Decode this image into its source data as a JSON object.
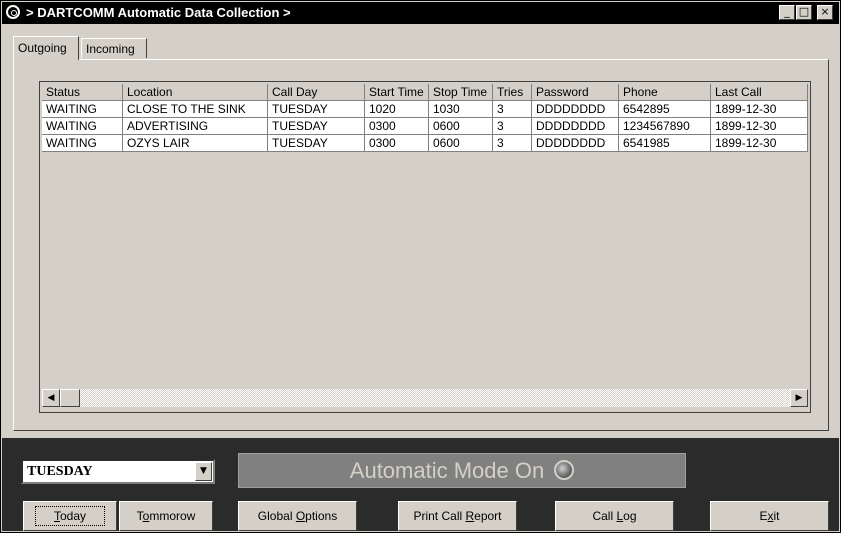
{
  "window": {
    "title": "> DARTCOMM Automatic Data Collection >",
    "min_glyph": "_",
    "max_glyph": "□",
    "close_glyph": "×"
  },
  "tabs": [
    {
      "label": "Outgoing",
      "active": true
    },
    {
      "label": "Incoming",
      "active": false
    }
  ],
  "grid": {
    "columns": [
      "Status",
      "Location",
      "Call Day",
      "Start Time",
      "Stop Time",
      "Tries",
      "Password",
      "Phone",
      "Last Call"
    ],
    "rows": [
      [
        "WAITING",
        "CLOSE TO THE SINK",
        "TUESDAY",
        "1020",
        "1030",
        "3",
        "DDDDDDDD",
        "6542895",
        "1899-12-30"
      ],
      [
        "WAITING",
        "ADVERTISING",
        "TUESDAY",
        "0300",
        "0600",
        "3",
        "DDDDDDDD",
        "1234567890",
        "1899-12-30"
      ],
      [
        "WAITING",
        "OZYS LAIR",
        "TUESDAY",
        "0300",
        "0600",
        "3",
        "DDDDDDDD",
        "6541985",
        "1899-12-30"
      ]
    ],
    "scroll_left_glyph": "◀",
    "scroll_right_glyph": "▶"
  },
  "controls": {
    "day_selected": "TUESDAY",
    "dropdown_glyph": "▼",
    "mode_text": "Automatic Mode On",
    "led_color": "#808080"
  },
  "buttons": {
    "today": {
      "pre": "",
      "key": "T",
      "post": "oday"
    },
    "tommorow": {
      "pre": "T",
      "key": "o",
      "post": "mmorow"
    },
    "global_options": {
      "pre": "Global ",
      "key": "O",
      "post": "ptions"
    },
    "print_call_report": {
      "pre": "Print Call ",
      "key": "R",
      "post": "eport"
    },
    "call_log": {
      "pre": "Call ",
      "key": "L",
      "post": "og"
    },
    "exit": {
      "pre": "E",
      "key": "x",
      "post": "it"
    }
  }
}
